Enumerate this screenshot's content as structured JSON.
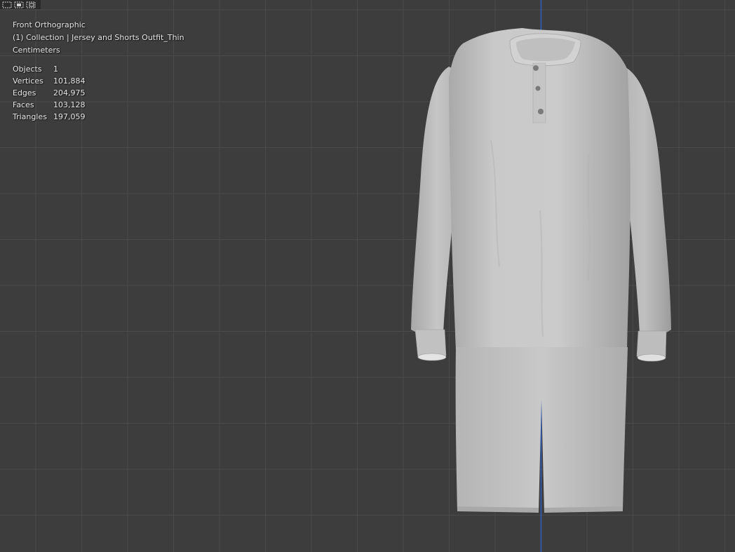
{
  "viewport": {
    "view_name": "Front Orthographic",
    "collection_line": "(1) Collection | Jersey and Shorts Outfit_Thin",
    "units": "Centimeters",
    "background_color": "#3d3d3d",
    "grid_color": "#4a4a4a",
    "axis_color": "#2f5fbf"
  },
  "stats": [
    {
      "label": "Objects",
      "value": "1"
    },
    {
      "label": "Vertices",
      "value": "101,884"
    },
    {
      "label": "Edges",
      "value": "204,975"
    },
    {
      "label": "Faces",
      "value": "103,128"
    },
    {
      "label": "Triangles",
      "value": "197,059"
    }
  ],
  "toolbar": {
    "icons": [
      "select-box-icon",
      "select-extend-icon",
      "select-subtract-icon"
    ]
  },
  "model": {
    "color": "#c4c4c4",
    "shade_color": "#9a9a9a"
  }
}
